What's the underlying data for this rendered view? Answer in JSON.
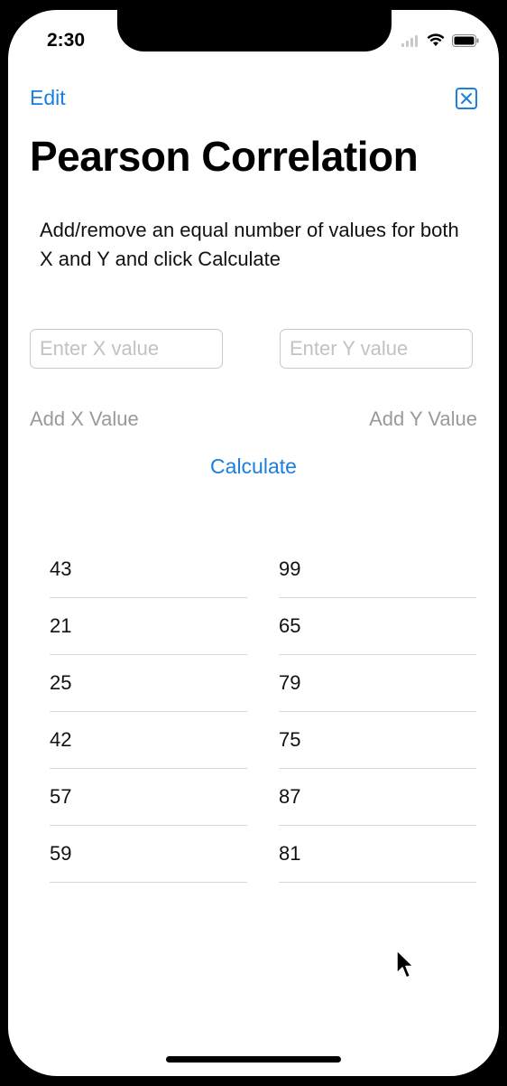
{
  "status_bar": {
    "time": "2:30"
  },
  "nav": {
    "edit_label": "Edit"
  },
  "title": "Pearson Correlation",
  "instructions": "Add/remove an equal number of values for both X and Y and click Calculate",
  "inputs": {
    "x_placeholder": "Enter X value",
    "y_placeholder": "Enter Y value"
  },
  "buttons": {
    "add_x": "Add X Value",
    "add_y": "Add Y Value",
    "calculate": "Calculate"
  },
  "x_values": [
    "43",
    "21",
    "25",
    "42",
    "57",
    "59"
  ],
  "y_values": [
    "99",
    "65",
    "79",
    "75",
    "87",
    "81"
  ],
  "colors": {
    "accent": "#1a7fe0",
    "disabled": "#9a9a9a"
  },
  "icons": {
    "close": "close-square-icon",
    "wifi": "wifi-icon",
    "battery": "battery-icon",
    "signal": "signal-icon"
  }
}
